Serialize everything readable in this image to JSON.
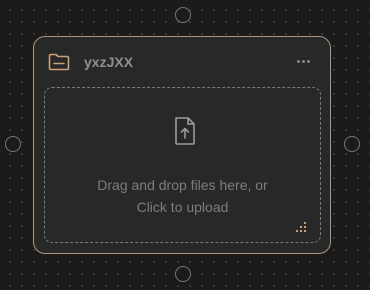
{
  "node": {
    "title": "yxzJXX",
    "icon": "folder-icon",
    "menu_icon": "more-horizontal-icon",
    "border_color": "#b0967c",
    "accent_color": "#c9a27a"
  },
  "dropzone": {
    "icon": "upload-file-icon",
    "line1": "Drag and drop files here, or",
    "line2": "Click to upload",
    "resize_icon": "resize-grip-icon"
  },
  "handles": [
    "top",
    "left",
    "right",
    "bottom"
  ]
}
